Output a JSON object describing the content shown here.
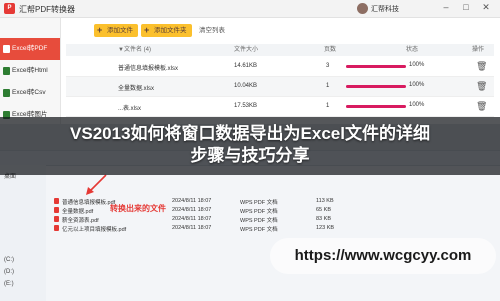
{
  "window": {
    "app_title": "汇帮PDF转换器",
    "username": "汇帮科技"
  },
  "sidebar": {
    "items": [
      {
        "label": "Excel转PDF",
        "active": true
      },
      {
        "label": "Excel转Html",
        "active": false
      },
      {
        "label": "Excel转Csv",
        "active": false
      },
      {
        "label": "Excel转图片",
        "active": false
      }
    ]
  },
  "toolbar": {
    "add_file_label": "添加文件",
    "add_folder_label": "添加文件夹",
    "clear_list_label": "清空列表"
  },
  "table": {
    "headers": {
      "name": "▼文件名 (4)",
      "size": "文件大小",
      "pages": "页数",
      "status": "状态",
      "action": "操作"
    },
    "rows": [
      {
        "name": "普通信息填报模板.xlsx",
        "size": "14.61KB",
        "pages": "3",
        "progress": 100,
        "pct": "100%"
      },
      {
        "name": "全量数据.xlsx",
        "size": "10.04KB",
        "pages": "1",
        "progress": 100,
        "pct": "100%"
      },
      {
        "name": "...表.xlsx",
        "size": "17.53KB",
        "pages": "1",
        "progress": 100,
        "pct": "100%"
      }
    ]
  },
  "explorer": {
    "nav_items": [
      "桌面",
      "(C:)",
      "(D:)",
      "(E:)"
    ],
    "files": [
      {
        "name": "普通信息填报模板.pdf",
        "date": "2024/8/11 18:07",
        "type": "WPS PDF 文档",
        "size": "113 KB"
      },
      {
        "name": "全量数据.pdf",
        "date": "2024/8/11 18:07",
        "type": "WPS PDF 文档",
        "size": "65 KB"
      },
      {
        "name": "薪全资源表.pdf",
        "date": "2024/8/11 18:07",
        "type": "WPS PDF 文档",
        "size": "83 KB"
      },
      {
        "name": "亿元以上项目填报模板.pdf",
        "date": "2024/8/11 18:07",
        "type": "WPS PDF 文档",
        "size": "123 KB"
      }
    ],
    "annotation": "转换出来的文件"
  },
  "overlay": {
    "headline_line1": "VS2013如何将窗口数据导出为Excel文件的详细",
    "headline_line2": "步骤与技巧分享",
    "watermark": "https://www.wcgcyy.com"
  },
  "colors": {
    "sidebar_active": "#e74c3c",
    "button_yellow": "#fbc02d",
    "progress": "#d81b60"
  }
}
